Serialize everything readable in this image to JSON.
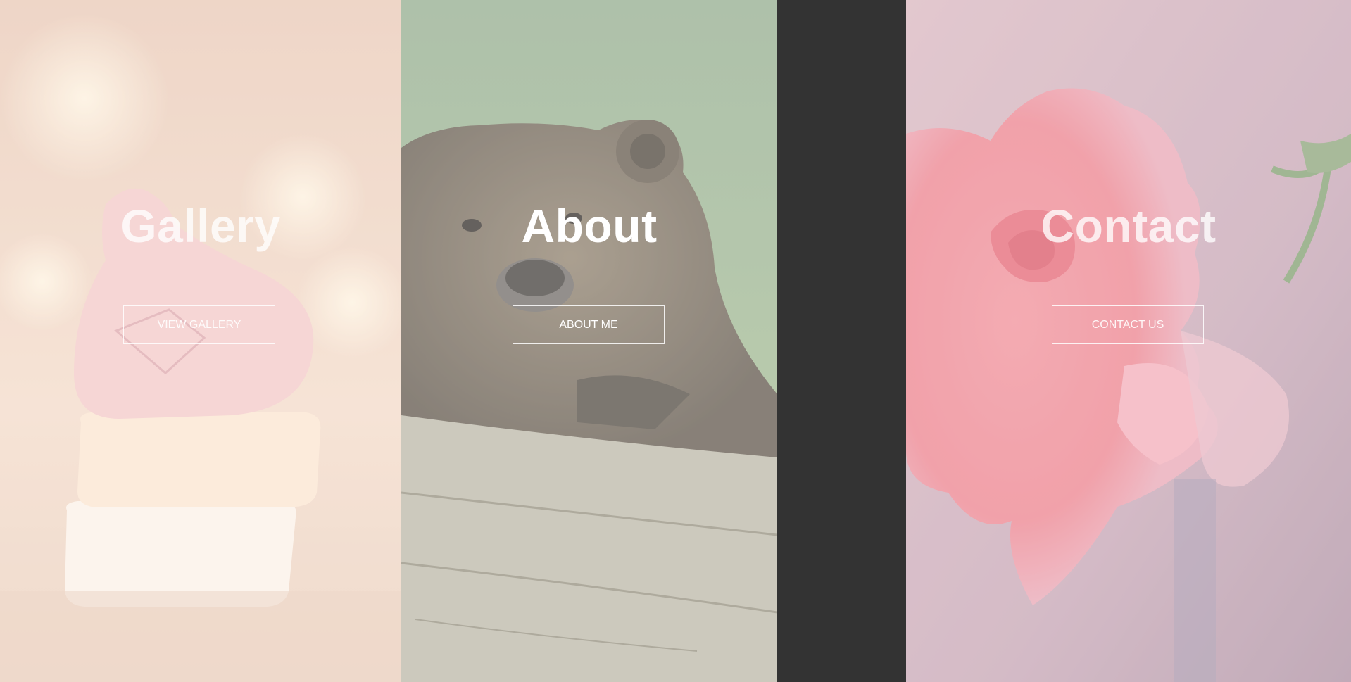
{
  "panels": {
    "gallery": {
      "title": "Gallery",
      "button_label": "VIEW GALLERY",
      "image_icon": "candy-hearts-photo"
    },
    "about": {
      "title": "About",
      "button_label": "ABOUT ME",
      "image_icon": "bear-photo"
    },
    "contact": {
      "title": "Contact",
      "button_label": "CONTACT US",
      "image_icon": "rose-photo"
    }
  },
  "colors": {
    "gap": "#333333",
    "title": "#ffffff",
    "button_border": "#ffffff",
    "gallery_tint": "#f1d3c0",
    "about_tint": "#6b6656",
    "contact_tint": "#c9a3b8",
    "rose": "#e8707f"
  }
}
